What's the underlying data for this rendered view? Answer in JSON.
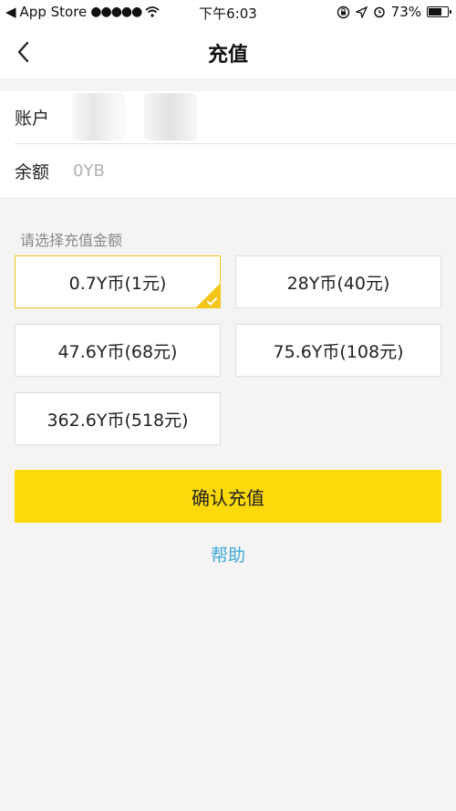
{
  "status_bar": {
    "carrier": "App Store",
    "signal": "●●●●●",
    "time": "下午6:03",
    "battery": "73%",
    "battery_level": 0.73
  },
  "nav": {
    "title": "充值"
  },
  "account": {
    "account_label": "账户",
    "balance_label": "余额",
    "balance_value": "0YB"
  },
  "recharge": {
    "section_label": "请选择充值金额",
    "options": [
      {
        "label": "0.7Y币(1元)",
        "selected": true
      },
      {
        "label": "28Y币(40元)",
        "selected": false
      },
      {
        "label": "47.6Y币(68元)",
        "selected": false
      },
      {
        "label": "75.6Y币(108元)",
        "selected": false
      },
      {
        "label": "362.6Y币(518元)",
        "selected": false
      }
    ],
    "confirm_label": "确认充值",
    "help_label": "帮助"
  },
  "colors": {
    "accent": "#fbd90b",
    "selected_border": "#f5c518",
    "link": "#3fa9d9"
  }
}
